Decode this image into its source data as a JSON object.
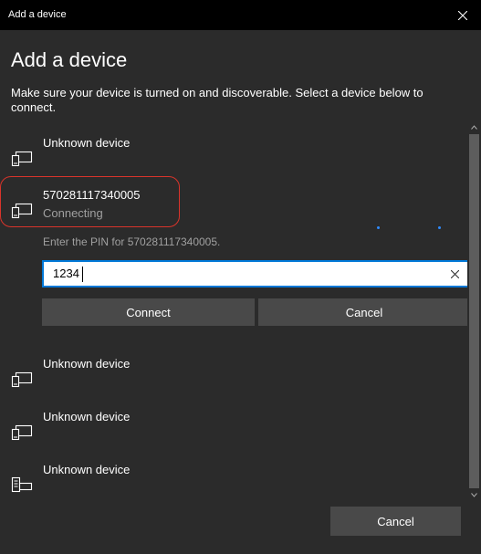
{
  "window": {
    "title": "Add a device"
  },
  "dialog": {
    "heading": "Add a device",
    "subtext": "Make sure your device is turned on and discoverable. Select a device below to connect."
  },
  "devices": [
    {
      "name": "Unknown device",
      "status": ""
    },
    {
      "name": "570281117340005",
      "status": "Connecting"
    },
    {
      "name": "Unknown device",
      "status": ""
    },
    {
      "name": "Unknown device",
      "status": ""
    },
    {
      "name": "Unknown device",
      "status": ""
    }
  ],
  "pairing": {
    "pin_label": "Enter the PIN for 570281117340005.",
    "pin_value": "1234",
    "connect_label": "Connect",
    "cancel_label": "Cancel"
  },
  "footer": {
    "cancel_label": "Cancel"
  },
  "icons": {
    "close": "close-icon",
    "device": "display-device-icon",
    "keyboard_device": "keyboard-device-icon",
    "clear": "clear-icon"
  },
  "colors": {
    "accent": "#0078d7",
    "highlight": "#d9342b",
    "dialog_bg": "#2b2b2b",
    "button_bg": "#494949"
  }
}
